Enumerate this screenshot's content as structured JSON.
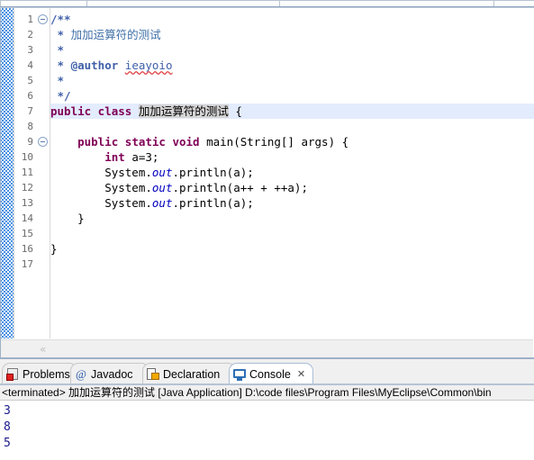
{
  "window": {
    "app": "MyEclipse",
    "editor_tab_segments": 4
  },
  "editor": {
    "name": "java-source-editor",
    "current_line": 7,
    "highlight_token": "加加运算符的测试",
    "scroll_left_marker": "«",
    "lines": [
      {
        "num": "1",
        "fold": true,
        "tokens": [
          {
            "t": "/**",
            "c": "tk-cmt-b"
          }
        ]
      },
      {
        "num": "2",
        "fold": false,
        "tokens": [
          {
            "t": " * ",
            "c": "tk-cmt-b"
          },
          {
            "t": "加加运算符的测试",
            "c": "tk-cmt"
          }
        ]
      },
      {
        "num": "3",
        "fold": false,
        "tokens": [
          {
            "t": " *",
            "c": "tk-cmt-b"
          }
        ]
      },
      {
        "num": "4",
        "fold": false,
        "tokens": [
          {
            "t": " * ",
            "c": "tk-cmt-b"
          },
          {
            "t": "@author",
            "c": "tk-cmt-b"
          },
          {
            "t": " ",
            "c": "tk-cmt"
          },
          {
            "t": "ieayoio",
            "c": "spell"
          }
        ]
      },
      {
        "num": "5",
        "fold": false,
        "tokens": [
          {
            "t": " *",
            "c": "tk-cmt-b"
          }
        ]
      },
      {
        "num": "6",
        "fold": false,
        "tokens": [
          {
            "t": " */",
            "c": "tk-cmt-b"
          }
        ]
      },
      {
        "num": "7",
        "fold": false,
        "tokens": [
          {
            "t": "public class ",
            "c": "tk-kw"
          },
          {
            "t": "加加运算符的测试",
            "c": "tk-cname"
          },
          {
            "t": " {",
            "c": "tk-plain"
          }
        ]
      },
      {
        "num": "8",
        "fold": false,
        "tokens": []
      },
      {
        "num": "9",
        "fold": true,
        "tokens": [
          {
            "t": "    ",
            "c": "tk-plain"
          },
          {
            "t": "public static void ",
            "c": "tk-kw"
          },
          {
            "t": "main(String[] args) {",
            "c": "tk-plain"
          }
        ]
      },
      {
        "num": "10",
        "fold": false,
        "tokens": [
          {
            "t": "        ",
            "c": "tk-plain"
          },
          {
            "t": "int",
            "c": "tk-kw"
          },
          {
            "t": " a=3;",
            "c": "tk-plain"
          }
        ]
      },
      {
        "num": "11",
        "fold": false,
        "tokens": [
          {
            "t": "        System.",
            "c": "tk-plain"
          },
          {
            "t": "out",
            "c": "tk-field"
          },
          {
            "t": ".println(a);",
            "c": "tk-plain"
          }
        ]
      },
      {
        "num": "12",
        "fold": false,
        "tokens": [
          {
            "t": "        System.",
            "c": "tk-plain"
          },
          {
            "t": "out",
            "c": "tk-field"
          },
          {
            "t": ".println(a++ + ++a);",
            "c": "tk-plain"
          }
        ]
      },
      {
        "num": "13",
        "fold": false,
        "tokens": [
          {
            "t": "        System.",
            "c": "tk-plain"
          },
          {
            "t": "out",
            "c": "tk-field"
          },
          {
            "t": ".println(a);",
            "c": "tk-plain"
          }
        ]
      },
      {
        "num": "14",
        "fold": false,
        "tokens": [
          {
            "t": "    }",
            "c": "tk-plain"
          }
        ]
      },
      {
        "num": "15",
        "fold": false,
        "tokens": []
      },
      {
        "num": "16",
        "fold": false,
        "tokens": [
          {
            "t": "}",
            "c": "tk-plain"
          }
        ]
      },
      {
        "num": "17",
        "fold": false,
        "tokens": []
      }
    ]
  },
  "bottom_view": {
    "tabs": [
      {
        "label": "Problems",
        "icon": "problems-icon",
        "active": false,
        "closeable": false
      },
      {
        "label": "Javadoc",
        "icon": "javadoc-icon",
        "active": false,
        "closeable": false
      },
      {
        "label": "Declaration",
        "icon": "declaration-icon",
        "active": false,
        "closeable": false
      },
      {
        "label": "Console",
        "icon": "console-icon",
        "active": true,
        "closeable": true
      }
    ],
    "close_glyph": "✕"
  },
  "console": {
    "status_line": "<terminated> 加加运算符的测试 [Java Application] D:\\code files\\Program Files\\MyEclipse\\Common\\bin",
    "output": [
      "3",
      "8",
      "5"
    ]
  },
  "colors": {
    "keyword": "#7f0055",
    "comment": "#3f6fa8",
    "field": "#0000c0",
    "current_line_bg": "#e3ecfd",
    "occurrence_bg": "#d4d4d4",
    "console_text": "#1a1a8c",
    "chrome": "#f0f0f0"
  }
}
